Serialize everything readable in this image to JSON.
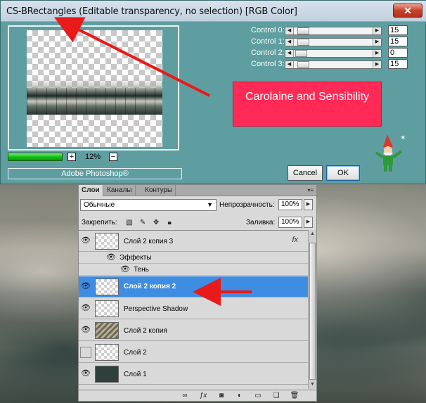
{
  "dialog": {
    "title": "CS-BRectangles (Editable transparency, no selection) [RGB Color]",
    "close_glyph": "✕",
    "zoom": "12%",
    "zoom_plus": "+",
    "zoom_minus": "−",
    "footer_label": "Adobe Photoshop®",
    "controls": [
      {
        "label": "Control 0:",
        "value": "15",
        "level": 0.15
      },
      {
        "label": "Control 1:",
        "value": "15",
        "level": 0.15
      },
      {
        "label": "Control 2:",
        "value": "0",
        "level": 0.0
      },
      {
        "label": "Control 3:",
        "value": "15",
        "level": 0.15
      }
    ],
    "callout": "Carolaine and Sensibility",
    "cancel_label": "Cancel",
    "ok_label": "OK",
    "progress": 1.0
  },
  "layers_panel": {
    "tabs": [
      "Слои",
      "Каналы",
      "Контуры"
    ],
    "active_tab": 0,
    "menu_glyph": "▾≡",
    "blend_mode": "Обычные",
    "opacity_label": "Непрозрачность:",
    "opacity_value": "100%",
    "lock_label": "Закрепить:",
    "fill_label": "Заливка:",
    "fill_value": "100%",
    "layers": [
      {
        "name": "Слой 2 копия 3",
        "visible": true,
        "fx": "fx"
      },
      {
        "name": "Слой 2 копия 2",
        "visible": true,
        "selected": true
      },
      {
        "name": "Perspective Shadow",
        "visible": true
      },
      {
        "name": "Слой 2 копия",
        "visible": true
      },
      {
        "name": "Слой 2",
        "visible": false
      },
      {
        "name": "Слой 1",
        "visible": true
      }
    ],
    "effects_label": "Эффекты",
    "shadow_label": "Тень"
  },
  "icons": {
    "eye": "eye-icon",
    "lock": "lock-icon",
    "brush": "brush-icon",
    "move": "move-icon",
    "link": "link-icon",
    "fx": "fx-icon",
    "mask": "mask-icon",
    "adjustment": "adjustment-icon",
    "folder": "folder-icon",
    "new_layer": "new-layer-icon",
    "trash": "trash-icon"
  },
  "colors": {
    "dialog_bg": "#5f9ea0",
    "callout_bg": "#ff2a55",
    "selection": "#3f8de3",
    "arrow": "#e81a1a"
  }
}
